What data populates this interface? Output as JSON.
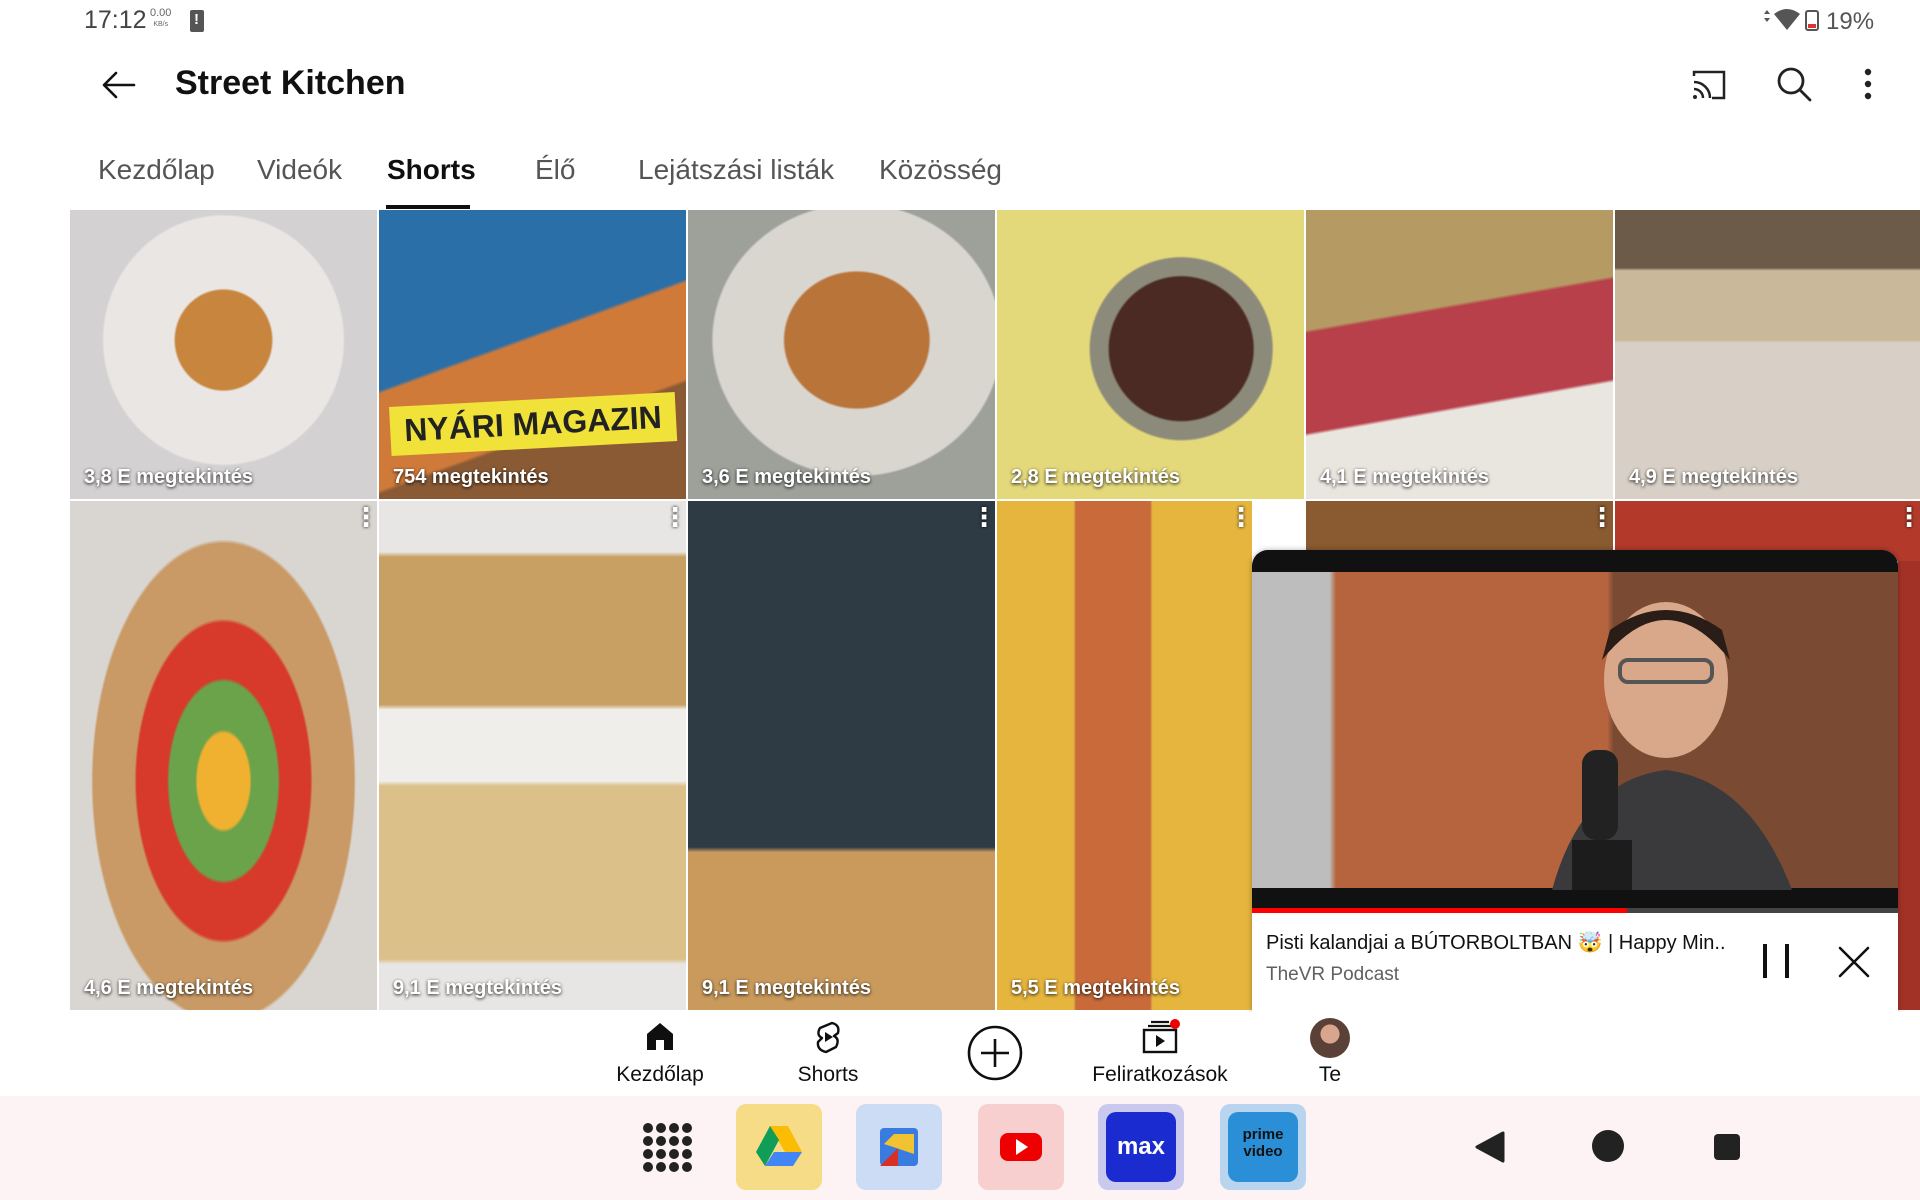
{
  "status_bar": {
    "time": "17:12",
    "net_speed": "0.00",
    "net_unit": "KB/s",
    "battery": "19%"
  },
  "header": {
    "title": "Street Kitchen"
  },
  "tabs": [
    {
      "label": "Kezdőlap",
      "active": false
    },
    {
      "label": "Videók",
      "active": false
    },
    {
      "label": "Shorts",
      "active": true
    },
    {
      "label": "Élő",
      "active": false
    },
    {
      "label": "Lejátszási listák",
      "active": false
    },
    {
      "label": "Közösség",
      "active": false
    }
  ],
  "shorts": [
    {
      "views": "3,8 E megtekintés",
      "subject": "round pastry on white plate"
    },
    {
      "views": "754 megtekintés",
      "subject": "magazine cover",
      "overlay": "NYÁRI MAGAZIN"
    },
    {
      "views": "3,6 E megtekintés",
      "subject": "spaghetti with tomatoes"
    },
    {
      "views": "2,8 E megtekintés",
      "subject": "chocolate balls in jar"
    },
    {
      "views": "4,1 E megtekintés",
      "subject": "chicken with sprouts bowl"
    },
    {
      "views": "4,9 E megtekintés",
      "subject": "wrap with dressing"
    },
    {
      "views": "4,6 E megtekintés",
      "subject": "vegetable bowl"
    },
    {
      "views": "9,1 E megtekintés",
      "subject": "fish with fries"
    },
    {
      "views": "9,1 E megtekintés",
      "subject": "apron and enamel mug"
    },
    {
      "views": "5,5 E megtekintés",
      "subject": "hot dog with fries"
    },
    {
      "views": "",
      "subject": "leopard print"
    },
    {
      "views": "",
      "subject": "red background"
    }
  ],
  "miniplayer": {
    "title": "Pisti kalandjai a BÚTORBOLTBAN 🤯 | Happy Min..",
    "channel": "TheVR Podcast",
    "progress": 0.58
  },
  "bottom_nav": [
    {
      "label": "Kezdőlap",
      "icon": "home-icon"
    },
    {
      "label": "Shorts",
      "icon": "shorts-icon"
    },
    {
      "label": "",
      "icon": "create-icon"
    },
    {
      "label": "Feliratkozások",
      "icon": "subscriptions-icon"
    },
    {
      "label": "Te",
      "icon": "avatar"
    }
  ],
  "dock": {
    "apps": [
      "drive-icon",
      "files-icon",
      "youtube-icon",
      "max-icon",
      "prime-video-icon"
    ],
    "max_label": "max",
    "prime_label_1": "prime",
    "prime_label_2": "video"
  },
  "colors": {
    "accent_red": "#ff0000",
    "text": "#0f0f0f",
    "secondary": "#606060"
  }
}
